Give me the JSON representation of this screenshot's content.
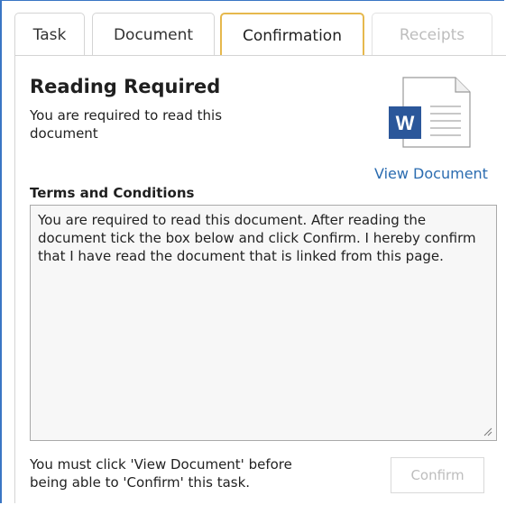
{
  "tabs": [
    {
      "label": "Task",
      "state": "normal"
    },
    {
      "label": "Document",
      "state": "normal"
    },
    {
      "label": "Confirmation",
      "state": "active"
    },
    {
      "label": "Receipts",
      "state": "disabled"
    }
  ],
  "header": {
    "title": "Reading Required",
    "subtitle": "You are required to read this document"
  },
  "document": {
    "icon": "word-document-icon",
    "icon_letter": "W",
    "link_label": "View Document"
  },
  "terms": {
    "label": "Terms and Conditions",
    "text": "You are required to read this document. After reading the document tick the box below and click Confirm. I hereby confirm that I have read the document that is linked from this page."
  },
  "footer": {
    "note": "You must click 'View Document' before being able to 'Confirm' this task.",
    "confirm_label": "Confirm"
  },
  "colors": {
    "frame_border": "#3a76c4",
    "active_tab_border": "#e6b84d",
    "link": "#2b6cb0",
    "word_blue": "#2b579a",
    "disabled_text": "#bdbdbd"
  }
}
